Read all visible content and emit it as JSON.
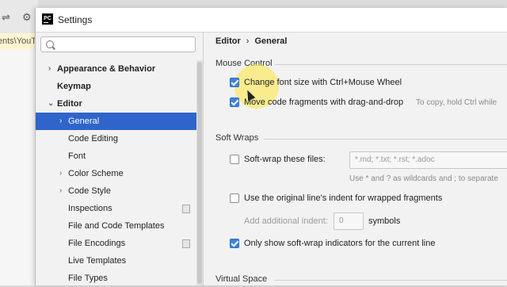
{
  "background": {
    "tab_text": "ents\\YouT"
  },
  "window": {
    "title": "Settings",
    "logo_text": "PC"
  },
  "sidebar": {
    "search_placeholder": "",
    "items": [
      {
        "label": "Appearance & Behavior",
        "chevron": "›",
        "bold": true
      },
      {
        "label": "Keymap",
        "bold": true
      },
      {
        "label": "Editor",
        "chevron": "⌄",
        "bold": true
      },
      {
        "label": "General",
        "chevron": "›",
        "selected": true
      },
      {
        "label": "Code Editing"
      },
      {
        "label": "Font"
      },
      {
        "label": "Color Scheme",
        "chevron": "›"
      },
      {
        "label": "Code Style",
        "chevron": "›"
      },
      {
        "label": "Inspections",
        "icon": "document-icon"
      },
      {
        "label": "File and Code Templates"
      },
      {
        "label": "File Encodings",
        "icon": "document-icon"
      },
      {
        "label": "Live Templates"
      },
      {
        "label": "File Types"
      }
    ]
  },
  "breadcrumb": {
    "parent": "Editor",
    "separator": "›",
    "current": "General"
  },
  "mouse_control": {
    "title": "Mouse Control",
    "change_font_size": {
      "label": "Change font size with Ctrl+Mouse Wheel",
      "checked": true
    },
    "move_fragments": {
      "label": "Move code fragments with drag-and-drop",
      "checked": true,
      "hint": "To copy, hold Ctrl while"
    }
  },
  "soft_wraps": {
    "title": "Soft Wraps",
    "soft_wrap_files": {
      "label": "Soft-wrap these files:",
      "checked": false,
      "value": "*.md; *.txt; *.rst; *.adoc",
      "hint": "Use * and ? as wildcards and ; to separate"
    },
    "original_indent": {
      "label": "Use the original line's indent for wrapped fragments",
      "checked": false
    },
    "additional_indent": {
      "label": "Add additional indent:",
      "value": "0",
      "suffix": "symbols"
    },
    "only_show_indicators": {
      "label": "Only show soft-wrap indicators for the current line",
      "checked": true
    }
  },
  "virtual_space": {
    "title": "Virtual Space"
  },
  "colors": {
    "selection": "#2f65ca",
    "checkbox_on": "#3d84e0",
    "highlight": "#ffe63c"
  }
}
